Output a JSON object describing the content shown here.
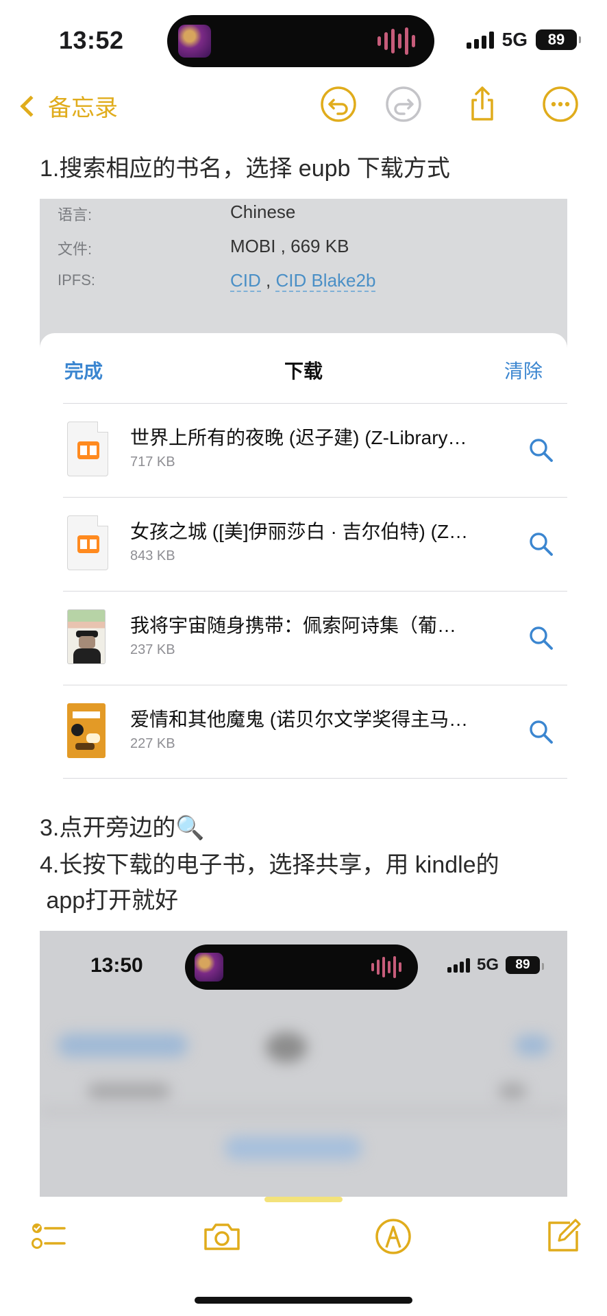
{
  "status_bar": {
    "time": "13:52",
    "network": "5G",
    "battery": "89"
  },
  "nav": {
    "back_label": "备忘录"
  },
  "note": {
    "step1": "1.搜索相应的书名，选择 eupb 下载方式",
    "step3": "3.点开旁边的🔍",
    "step4": "4.长按下载的电子书，选择共享，用 kindle的\n app打开就好"
  },
  "book_meta": {
    "language_label": "语言:",
    "language_value": "Chinese",
    "file_label": "文件:",
    "file_value": "MOBI , 669 KB",
    "ipfs_label": "IPFS:",
    "cid": "CID",
    "separator": " , ",
    "cid_blake": "CID Blake2b"
  },
  "downloads_sheet": {
    "done_label": "完成",
    "title": "下载",
    "clear_label": "清除",
    "items": [
      {
        "name": "世界上所有的夜晚 (迟子建) (Z-Library).epub",
        "size": "717 KB",
        "icon": "epub-file-icon"
      },
      {
        "name": "女孩之城 ([美]伊丽莎白 · 吉尔伯特) (Z-Library).epub",
        "size": "843 KB",
        "icon": "epub-file-icon"
      },
      {
        "name": "我将宇宙随身携带：佩索阿诗集（葡萄牙）.epub",
        "size": "237 KB",
        "icon": "book-cover-icon"
      },
      {
        "name": "爱情和其他魔鬼 (诺贝尔文学奖得主马尔克斯).epub",
        "size": "227 KB",
        "icon": "book-cover-icon"
      }
    ]
  },
  "second_screenshot": {
    "time": "13:50",
    "network": "5G",
    "battery": "89"
  },
  "colors": {
    "accent": "#e0ac1c",
    "link": "#3b86d0"
  }
}
